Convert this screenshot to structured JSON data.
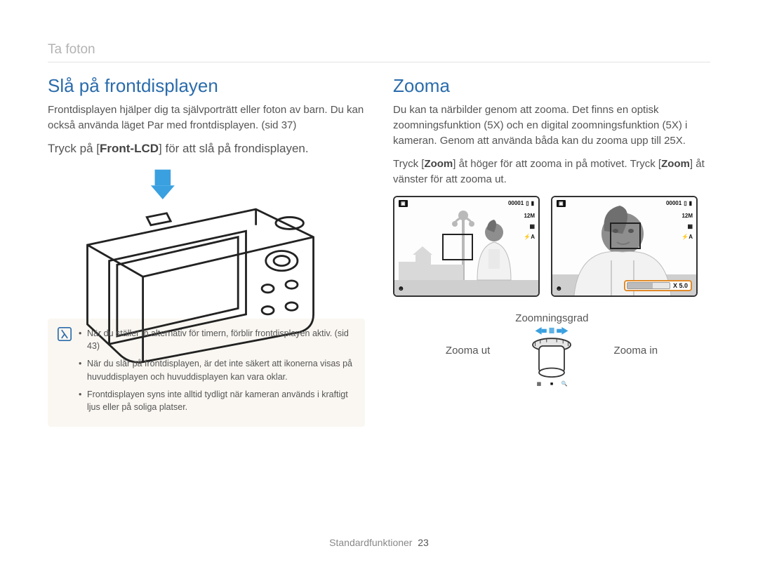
{
  "chapter": "Ta foton",
  "left": {
    "heading": "Slå på frontdisplayen",
    "intro": "Frontdisplayen hjälper dig ta självporträtt eller foton av barn. Du kan också använda läget Par med frontdisplayen. (sid 37)",
    "instruction_pre": "Tryck på [",
    "instruction_bold": "Front-LCD",
    "instruction_post": "] för att slå på frondisplayen.",
    "notes": [
      "När du ställer in alternativ för timern, förblir frontdisplayen aktiv. (sid 43)",
      "När du slår på frontdisplayen, är det inte säkert att ikonerna visas på huvuddisplayen och huvuddisplayen kan vara oklar.",
      "Frontdisplayen syns inte alltid tydligt när kameran används i kraftigt ljus eller på soliga platser."
    ]
  },
  "right": {
    "heading": "Zooma",
    "intro": "Du kan ta närbilder genom att zooma. Det finns en optisk zoomningsfunktion (5X) och en digital zoomningsfunktion (5X) i kameran. Genom att använda båda kan du zooma upp till 25X.",
    "instruction_pre": "Tryck [",
    "instruction_bold1": "Zoom",
    "instruction_mid": "] åt höger för att zooma in på motivet. Tryck [",
    "instruction_bold2": "Zoom",
    "instruction_post": "] åt vänster för att zooma ut.",
    "osd": {
      "counter": "00001",
      "res": "12M",
      "iso_icon": "ISO",
      "flash_icon": "⚡A",
      "zoom_value": "X 5.0"
    },
    "labels": {
      "zoomningsgrad": "Zoomningsgrad",
      "zoom_out": "Zooma ut",
      "zoom_in": "Zooma in"
    }
  },
  "footer": {
    "section": "Standardfunktioner",
    "page": "23"
  },
  "colors": {
    "heading_blue": "#2b6cab",
    "accent_orange": "#e08a2a",
    "arrow_blue": "#3aa0e0"
  }
}
